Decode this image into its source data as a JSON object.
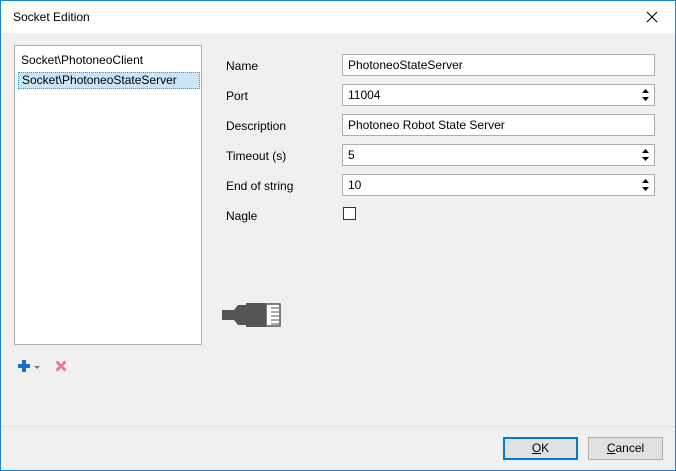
{
  "window": {
    "title": "Socket Edition"
  },
  "socket_list": {
    "items": [
      {
        "label": "Socket\\PhotoneoClient",
        "selected": false
      },
      {
        "label": "Socket\\PhotoneoStateServer",
        "selected": true
      }
    ]
  },
  "list_toolbar": {
    "add_icon": "plus-icon",
    "add_dropdown_icon": "caret-down-icon",
    "delete_icon": "delete-x-icon",
    "add_color": "#1e6fc4",
    "delete_color": "#e07b91"
  },
  "form": {
    "name": {
      "label": "Name",
      "value": "PhotoneoStateServer"
    },
    "port": {
      "label": "Port",
      "value": "11004"
    },
    "description": {
      "label": "Description",
      "value": "Photoneo Robot State Server"
    },
    "timeout": {
      "label": "Timeout (s)",
      "value": "5"
    },
    "end_of_string": {
      "label": "End of string",
      "value": "10"
    },
    "nagle": {
      "label": "Nagle",
      "checked": false
    }
  },
  "illustration": {
    "icon": "ethernet-plug-icon"
  },
  "footer": {
    "ok_label_mnemonic": "O",
    "ok_label_rest": "K",
    "cancel_label_mnemonic": "C",
    "cancel_label_rest": "ancel"
  },
  "colors": {
    "accent_border": "#1883d7",
    "selection_bg": "#cce4f7",
    "default_button_border": "#0078d7"
  }
}
